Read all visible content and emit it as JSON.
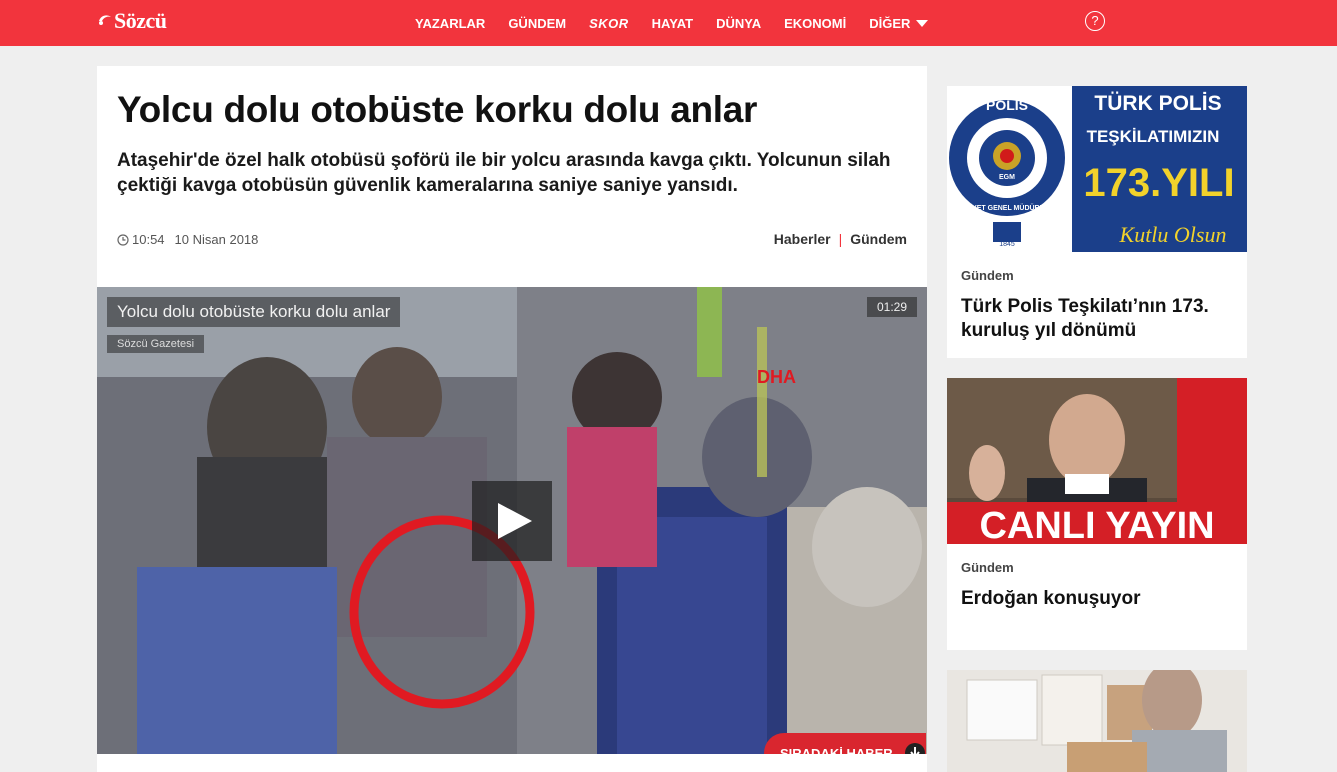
{
  "header": {
    "logo": "Sözcü",
    "nav": [
      "YAZARLAR",
      "GÜNDEM",
      "SKOR",
      "HAYAT",
      "DÜNYA",
      "EKONOMİ",
      "DİĞER"
    ],
    "help_icon": "question-circle-icon",
    "brand_color": "#f2343d"
  },
  "article": {
    "title": "Yolcu dolu otobüste korku dolu anlar",
    "summary": "Ataşehir'de özel halk otobüsü şoförü ile bir yolcu arasında kavga çıktı. Yolcunun silah çektiği kavga otobüsün güvenlik kameralarına saniye saniye yansıdı.",
    "time": "10:54",
    "date": "10 Nisan 2018",
    "category_1": "Haberler",
    "separator": "|",
    "category_2": "Gündem"
  },
  "video": {
    "title": "Yolcu dolu otobüste korku dolu anlar",
    "source": "Sözcü Gazetesi",
    "duration": "01:29",
    "watermark": "DHA",
    "next_label": "SIRADAKİ HABER"
  },
  "sidebar": [
    {
      "banner_line1": "TÜRK POLİS",
      "banner_line2": "TEŞKİLATIMIZIN",
      "banner_line3": "173.YILI",
      "banner_line4": "Kutlu Olsun",
      "badge_top": "POLİS",
      "badge_bottom": "EMNİYET GENEL MÜDÜRLÜĞÜ",
      "badge_center": "EGM",
      "badge_year": "1845",
      "category": "Gündem",
      "title": "Türk Polis Teşkilatı’nın 173. kuruluş yıl dönümü"
    },
    {
      "banner_text": "CANLI YAYIN",
      "category": "Gündem",
      "title": "Erdoğan konuşuyor"
    },
    {
      "category": "",
      "title": ""
    }
  ]
}
